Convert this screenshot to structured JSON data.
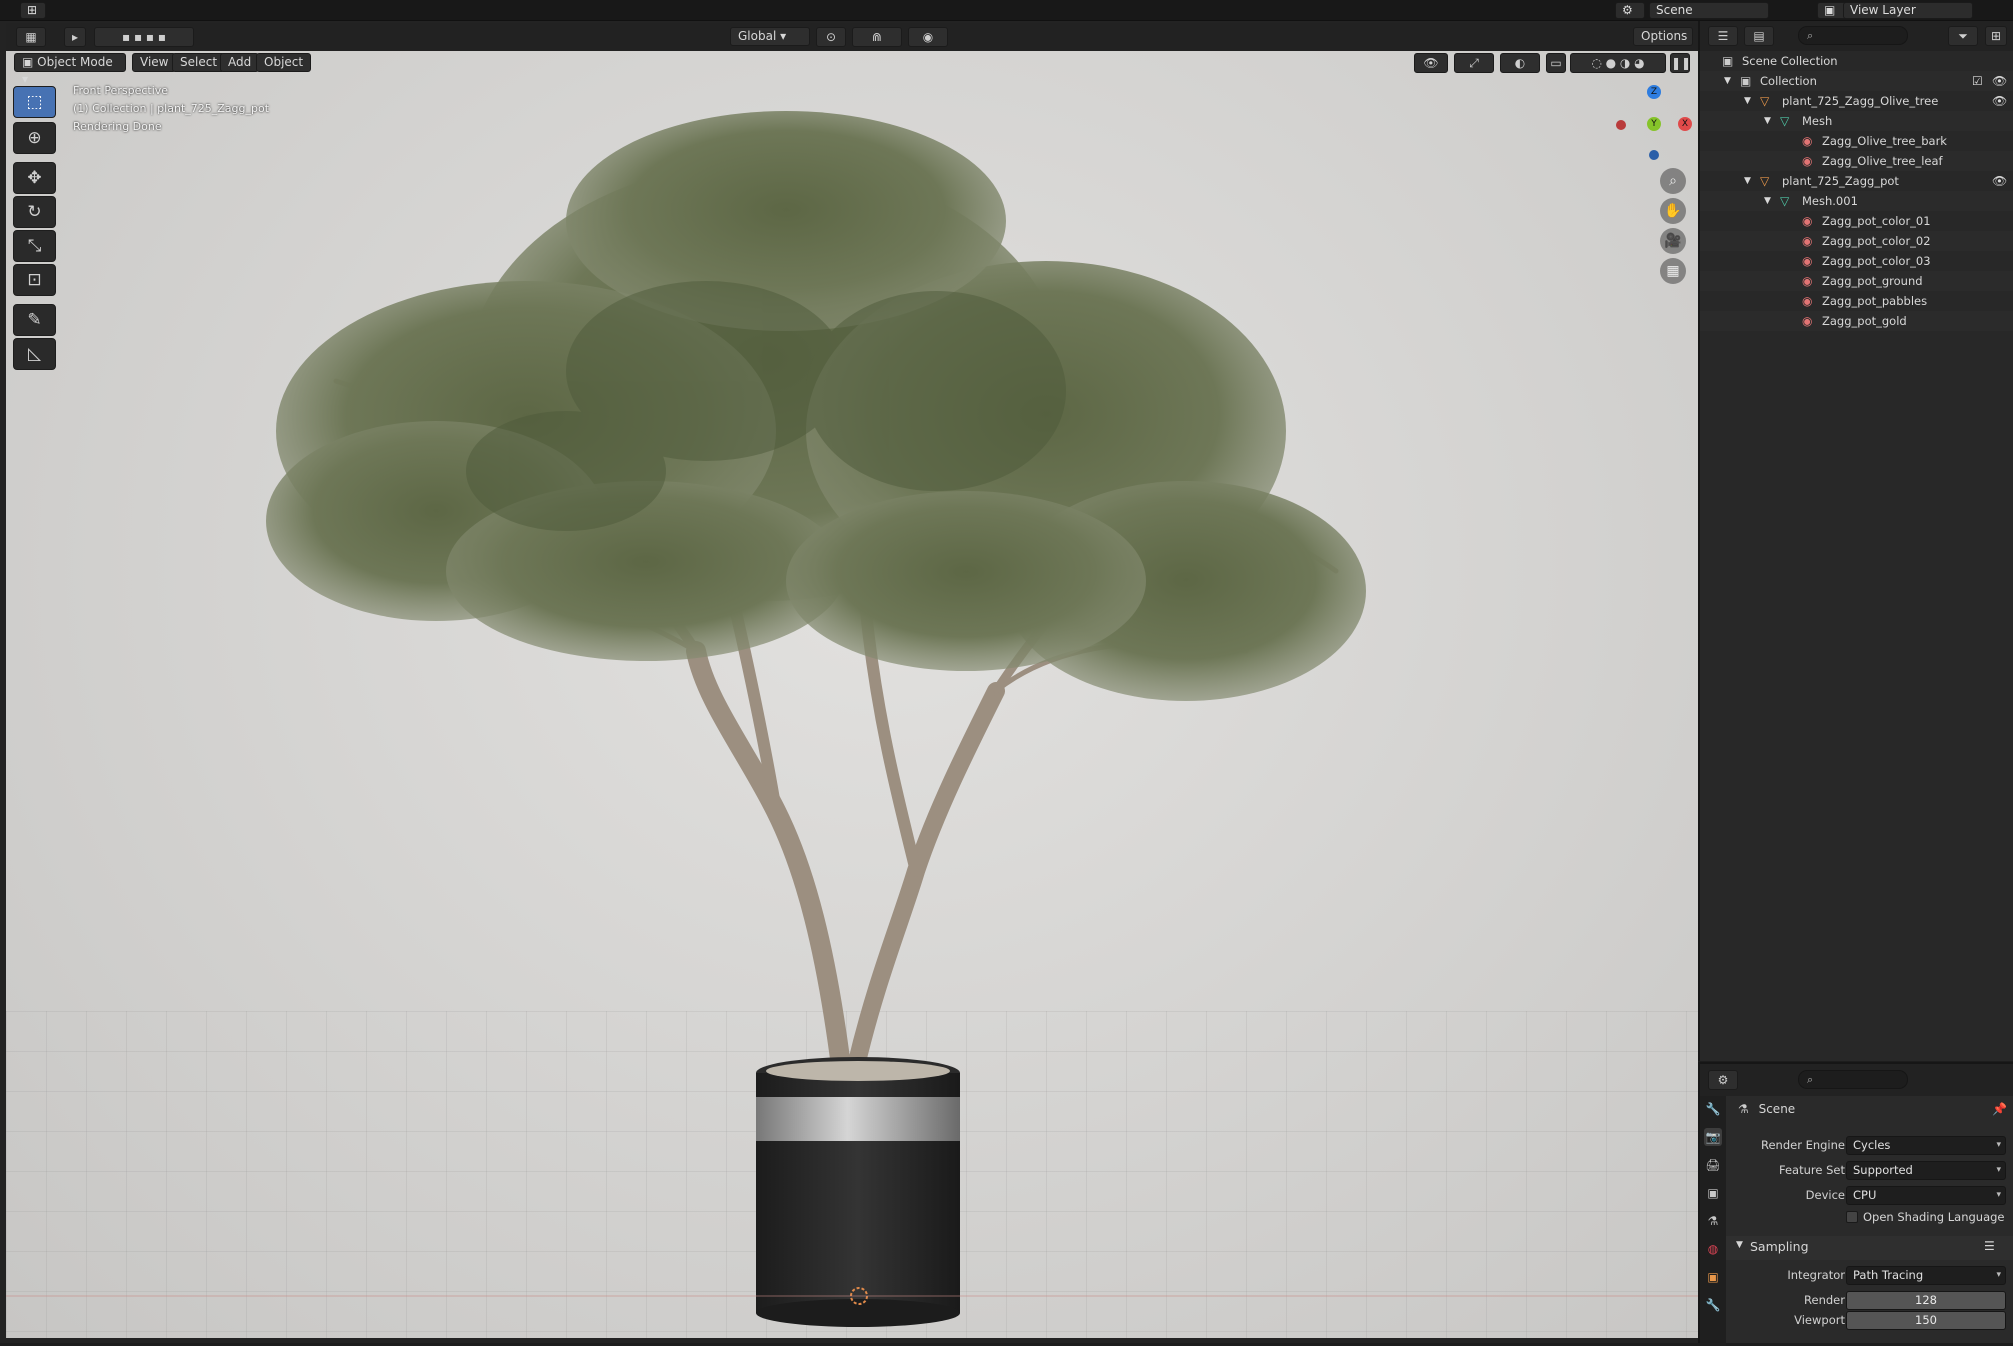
{
  "topbar": {
    "scene": "Scene",
    "view_layer": "View Layer"
  },
  "header": {
    "mode": "Object Mode",
    "menus": [
      "View",
      "Select",
      "Add",
      "Object"
    ],
    "orientation": "Global",
    "options": "Options"
  },
  "viewport": {
    "info_lines": [
      "Front Perspective",
      "(1) Collection | plant_725_Zagg_pot",
      "Rendering Done"
    ],
    "gizmo": {
      "x": "X",
      "y": "Y",
      "z": "Z"
    }
  },
  "outliner": {
    "search_placeholder": "",
    "items": [
      {
        "label": "Scene Collection"
      },
      {
        "label": "Collection"
      },
      {
        "label": "plant_725_Zagg_Olive_tree"
      },
      {
        "label": "Mesh"
      },
      {
        "label": "Zagg_Olive_tree_bark"
      },
      {
        "label": "Zagg_Olive_tree_leaf"
      },
      {
        "label": "plant_725_Zagg_pot"
      },
      {
        "label": "Mesh.001"
      },
      {
        "label": "Zagg_pot_color_01"
      },
      {
        "label": "Zagg_pot_color_02"
      },
      {
        "label": "Zagg_pot_color_03"
      },
      {
        "label": "Zagg_pot_ground"
      },
      {
        "label": "Zagg_pot_pabbles"
      },
      {
        "label": "Zagg_pot_gold"
      }
    ]
  },
  "properties": {
    "context": "Scene",
    "render_engine_label": "Render Engine",
    "render_engine": "Cycles",
    "feature_set_label": "Feature Set",
    "feature_set": "Supported",
    "device_label": "Device",
    "device": "CPU",
    "osl_label": "Open Shading Language",
    "sampling_label": "Sampling",
    "integrator_label": "Integrator",
    "integrator": "Path Tracing",
    "render_label": "Render",
    "render_samples": "128",
    "viewport_label": "Viewport",
    "viewport_samples": "150"
  },
  "colors": {
    "accent": "#4772b3",
    "leaf": "#6b7552",
    "bark": "#9a8c7c",
    "pot": "#2b2b2b"
  }
}
